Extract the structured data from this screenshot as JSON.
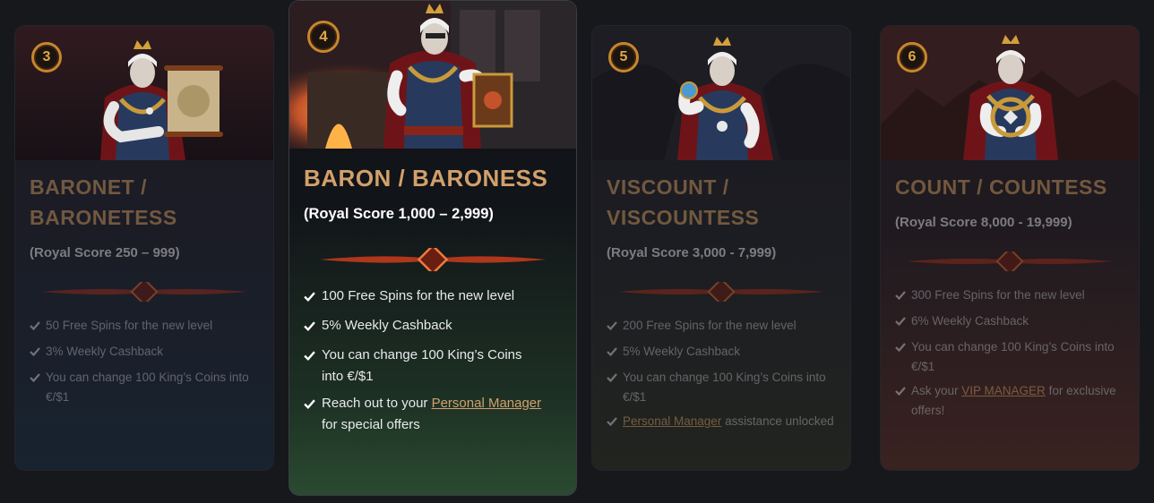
{
  "colors": {
    "gold": "#b98a58",
    "gold_bright": "#e3a548",
    "text_dim": "#8d8f96",
    "text_active": "#e9e9ea",
    "page_bg": "#17181c"
  },
  "tiers": [
    {
      "level": "3",
      "title_line1": "BARONET / BARONETESS",
      "title_line2": "",
      "score": "(Royal Score 250 – 999)",
      "perks": [
        {
          "text": "50 Free Spins for the new level"
        },
        {
          "text": "3% Weekly Cashback"
        },
        {
          "text": "You can change 100 King’s Coins into €/$1"
        }
      ]
    },
    {
      "level": "4",
      "title_line1": "BARON / BARONESS",
      "title_line2": "",
      "score": "(Royal Score 1,000 – 2,999)",
      "perks": [
        {
          "text": "100 Free Spins for the new level"
        },
        {
          "text": "5% Weekly Cashback"
        },
        {
          "text": "You can change 100 King’s Coins into €/$1"
        },
        {
          "pre": "Reach out to your ",
          "link": "Personal Manager",
          "post": " for special offers"
        }
      ]
    },
    {
      "level": "5",
      "title_line1": "VISCOUNT /",
      "title_line2": "VISCOUNTESS",
      "score": "(Royal Score 3,000 - 7,999)",
      "perks": [
        {
          "text": "200 Free Spins for the new level"
        },
        {
          "text": "5% Weekly Cashback"
        },
        {
          "text": "You can change 100 King’s Coins into €/$1"
        },
        {
          "pre": "",
          "link": "Personal Manager",
          "post": " assistance unlocked"
        }
      ]
    },
    {
      "level": "6",
      "title_line1": "COUNT / COUNTESS",
      "title_line2": "",
      "score": "(Royal Score 8,000 - 19,999)",
      "perks": [
        {
          "text": "300 Free Spins for the new level"
        },
        {
          "text": "6% Weekly Cashback"
        },
        {
          "text": "You can change 100 King’s Coins into €/$1"
        },
        {
          "pre": "Ask your ",
          "link": "VIP MANAGER",
          "post": " for exclusive offers!"
        }
      ]
    }
  ]
}
